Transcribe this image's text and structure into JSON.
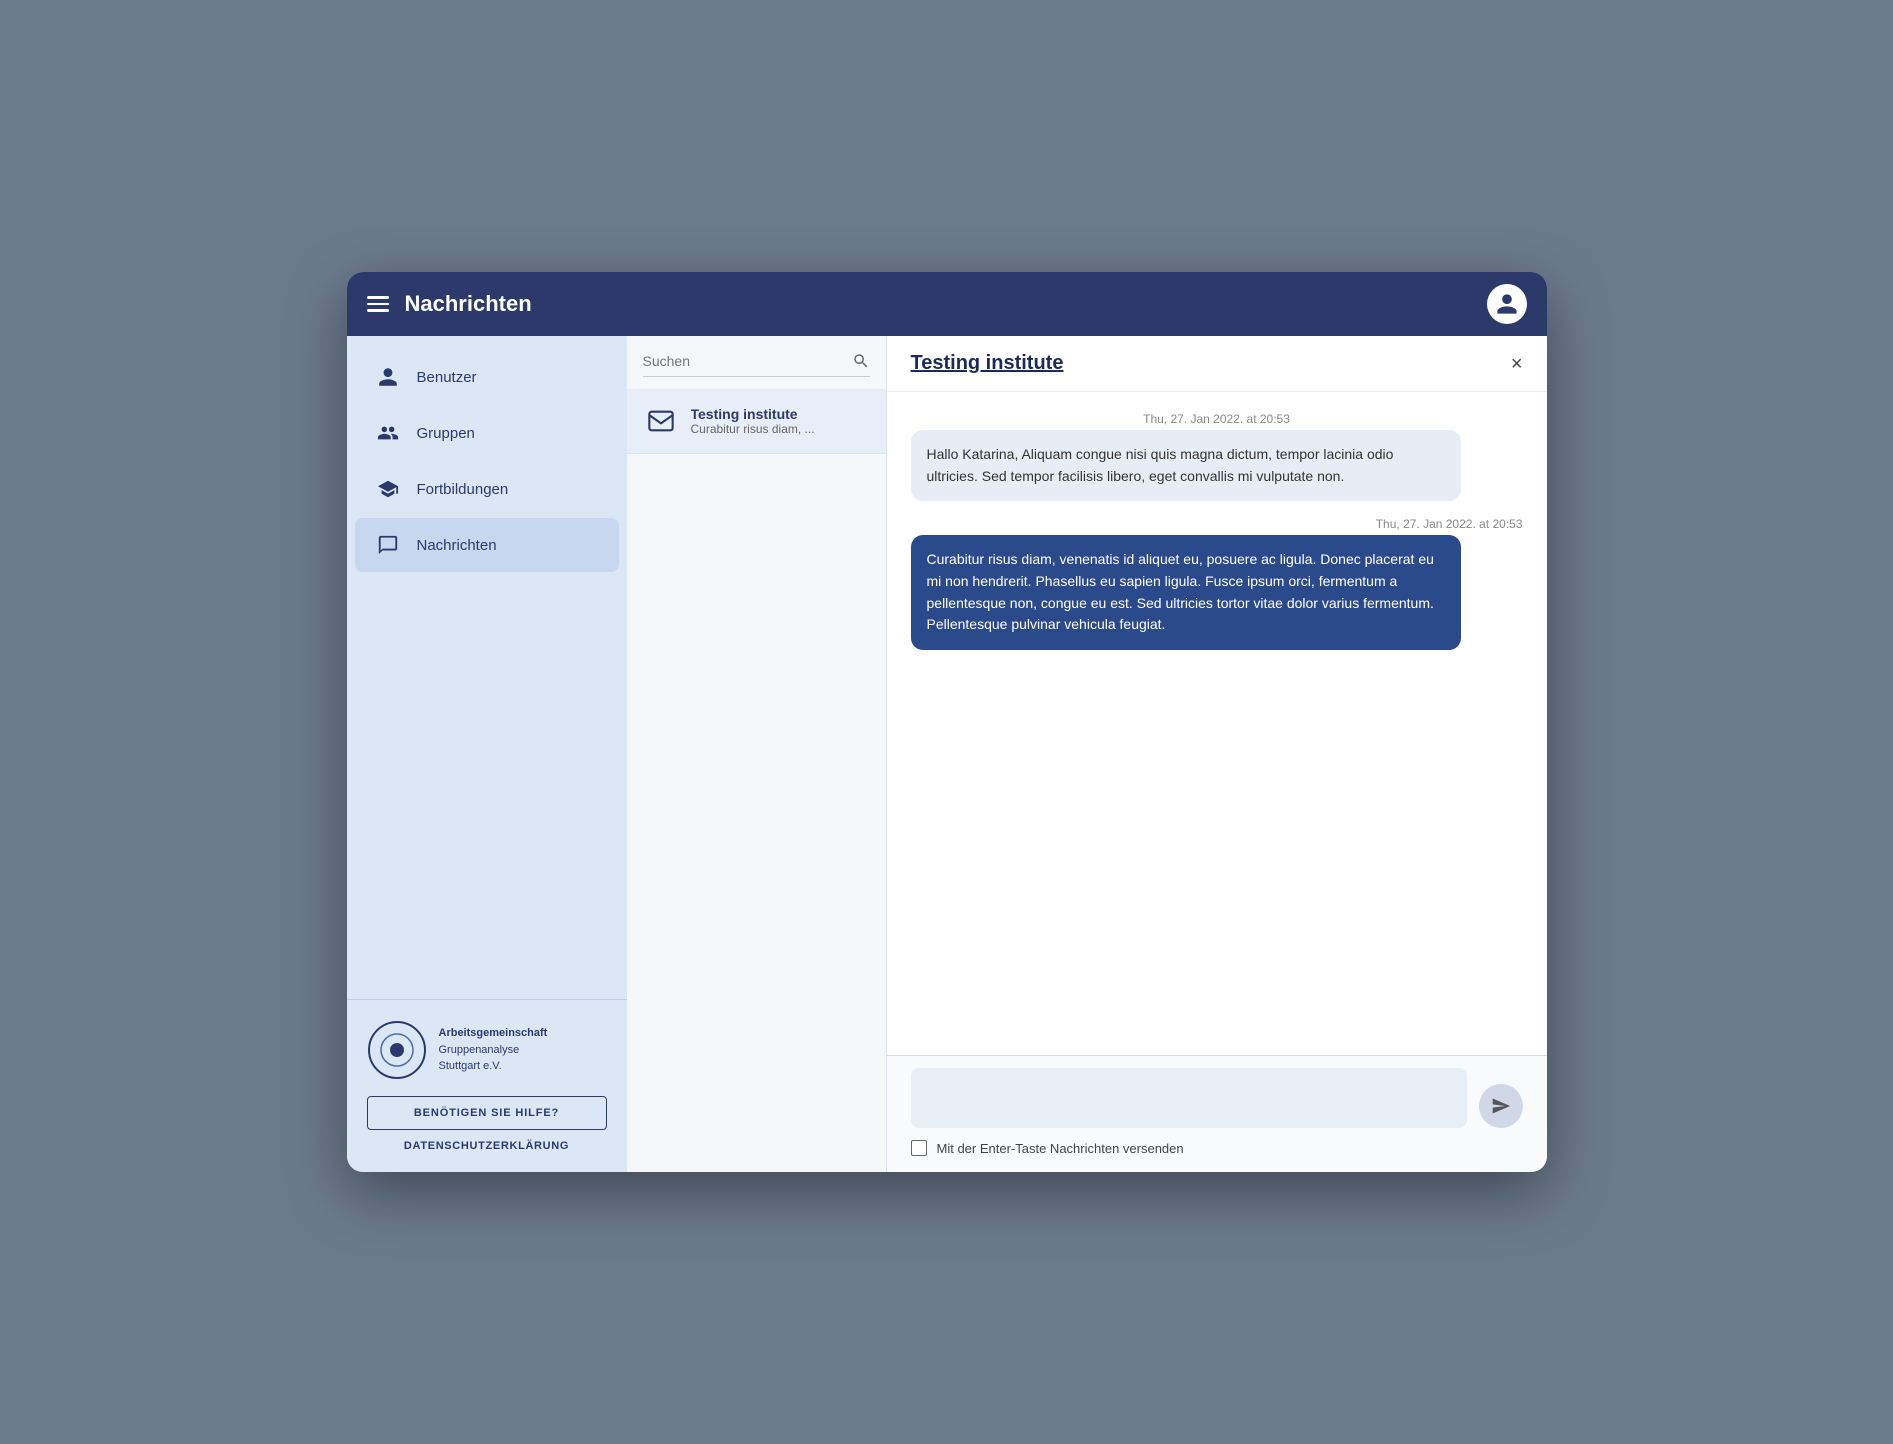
{
  "header": {
    "title": "Nachrichten",
    "avatar_label": "User avatar"
  },
  "sidebar": {
    "items": [
      {
        "id": "benutzer",
        "label": "Benutzer",
        "icon": "user-icon",
        "active": false
      },
      {
        "id": "gruppen",
        "label": "Gruppen",
        "icon": "groups-icon",
        "active": false
      },
      {
        "id": "fortbildungen",
        "label": "Fortbildungen",
        "icon": "education-icon",
        "active": false
      },
      {
        "id": "nachrichten",
        "label": "Nachrichten",
        "icon": "messages-icon",
        "active": true
      }
    ],
    "logo": {
      "line1": "Arbeitsgemeinschaft",
      "line2": "Gruppenanalyse",
      "line3": "Stuttgart e.V."
    },
    "help_button": "BENÖTIGEN SIE HILFE?",
    "datenschutz": "DATENSCHUTZERKLÄRUNG"
  },
  "messages_list": {
    "search_placeholder": "Suchen",
    "items": [
      {
        "title": "Testing institute",
        "preview": "Curabitur risus diam, ..."
      }
    ]
  },
  "chat": {
    "title": "Testing institute",
    "close_label": "×",
    "messages": [
      {
        "type": "incoming",
        "timestamp": "Thu, 27. Jan 2022. at 20:53",
        "text": "Hallo Katarina, Aliquam congue nisi quis magna dictum, tempor lacinia odio ultricies. Sed tempor facilisis libero, eget convallis mi vulputate non."
      },
      {
        "type": "outgoing",
        "timestamp": "Thu, 27. Jan 2022. at 20:53",
        "text": "Curabitur risus diam, venenatis id aliquet eu, posuere ac ligula. Donec placerat eu mi non hendrerit. Phasellus eu sapien ligula. Fusce ipsum orci, fermentum a pellentesque non, congue eu est. Sed ultricies tortor vitae dolor varius fermentum. Pellentesque pulvinar vehicula feugiat."
      }
    ],
    "input_placeholder": "",
    "enter_label": "Mit der Enter-Taste Nachrichten versenden",
    "send_label": "Send"
  }
}
